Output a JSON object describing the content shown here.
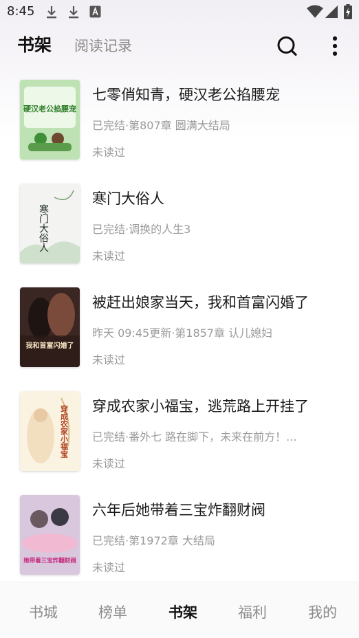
{
  "status_bar": {
    "time": "8:45",
    "icons": [
      "download-icon",
      "download-icon",
      "accessibility-icon",
      "wifi-icon",
      "signal-icon",
      "battery-charging-icon"
    ]
  },
  "header": {
    "tab_active": "书架",
    "tab_inactive": "阅读记录",
    "search_icon": "search-icon",
    "more_icon": "more-vertical-icon"
  },
  "books": [
    {
      "title": "七零俏知青，硬汉老公掐腰宠",
      "status": "已完结·第807章 圆满大结局",
      "read": "未读过",
      "cover_text": "硬汉老公掐腰宠",
      "cover_colors": [
        "#bfe2b4",
        "#f6fbf1",
        "#3f8f38"
      ]
    },
    {
      "title": "寒门大俗人",
      "status": "已完结·调换的人生3",
      "read": "未读过",
      "cover_text": "寒门大俗人",
      "cover_colors": [
        "#f3f4f2",
        "#e7ede6",
        "#1f2a22"
      ]
    },
    {
      "title": "被赶出娘家当天，我和首富闪婚了",
      "status": "昨天 09:45更新·第1857章 认儿媳妇",
      "read": "未读过",
      "cover_text": "我和首富闪婚了",
      "cover_colors": [
        "#3a2622",
        "#7a4a3a",
        "#f3e2c0"
      ]
    },
    {
      "title": "穿成农家小福宝，逃荒路上开挂了",
      "status": "已完结·番外七 路在脚下，未来在前方！...",
      "read": "未读过",
      "cover_text": "穿成农家小福宝",
      "cover_colors": [
        "#fbf3e2",
        "#f1dfbf",
        "#b0401f"
      ]
    },
    {
      "title": "六年后她带着三宝炸翻财阀",
      "status": "已完结·第1972章 大结局",
      "read": "未读过",
      "cover_text": "她带着三宝炸翻财阀",
      "cover_colors": [
        "#d9c7de",
        "#f1b9d2",
        "#c4287c"
      ]
    }
  ],
  "bottom_nav": [
    {
      "label": "书城",
      "active": false
    },
    {
      "label": "榜单",
      "active": false
    },
    {
      "label": "书架",
      "active": true
    },
    {
      "label": "福利",
      "active": false
    },
    {
      "label": "我的",
      "active": false
    }
  ]
}
